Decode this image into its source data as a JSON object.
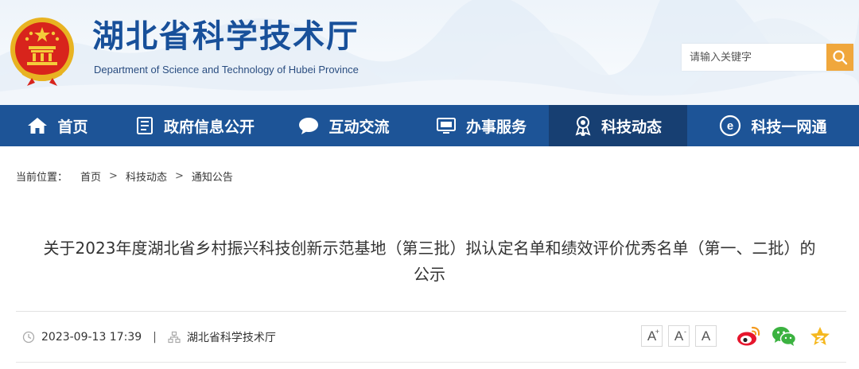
{
  "header": {
    "site_title": "湖北省科学技术厅",
    "site_subtitle": "Department of Science and Technology of Hubei Province",
    "search": {
      "placeholder": "请输入关键字"
    },
    "icons": {
      "emblem": "national-emblem",
      "search": "search-icon"
    }
  },
  "nav": {
    "items": [
      {
        "label": "首页",
        "icon": "home-icon"
      },
      {
        "label": "政府信息公开",
        "icon": "document-list-icon"
      },
      {
        "label": "互动交流",
        "icon": "chat-bubble-icon"
      },
      {
        "label": "办事服务",
        "icon": "monitor-icon"
      },
      {
        "label": "科技动态",
        "icon": "award-medal-icon",
        "active": true
      },
      {
        "label": "科技一网通",
        "icon": "e-circle-icon"
      }
    ]
  },
  "breadcrumb": {
    "label": "当前位置：",
    "items": [
      "首页",
      "科技动态",
      "通知公告"
    ],
    "separator": ">"
  },
  "article": {
    "title_line1": "关于2023年度湖北省乡村振兴科技创新示范基地（第三批）拟认定名单和绩效评价优秀名单（第一、二批）的",
    "title_line2": "公示",
    "date": "2023-09-13 17:39",
    "separator": "|",
    "source": "湖北省科学技术厅"
  },
  "font_size_buttons": [
    {
      "label": "A",
      "mark": "+"
    },
    {
      "label": "A",
      "mark": "-"
    },
    {
      "label": "A",
      "mark": ""
    }
  ],
  "share": [
    "weibo-icon",
    "wechat-icon",
    "favorite-star-icon"
  ],
  "colors": {
    "nav_bg": "#1d5497",
    "nav_active_bg": "#173f72",
    "title_blue": "#18509a",
    "search_button": "#f0a73c"
  }
}
